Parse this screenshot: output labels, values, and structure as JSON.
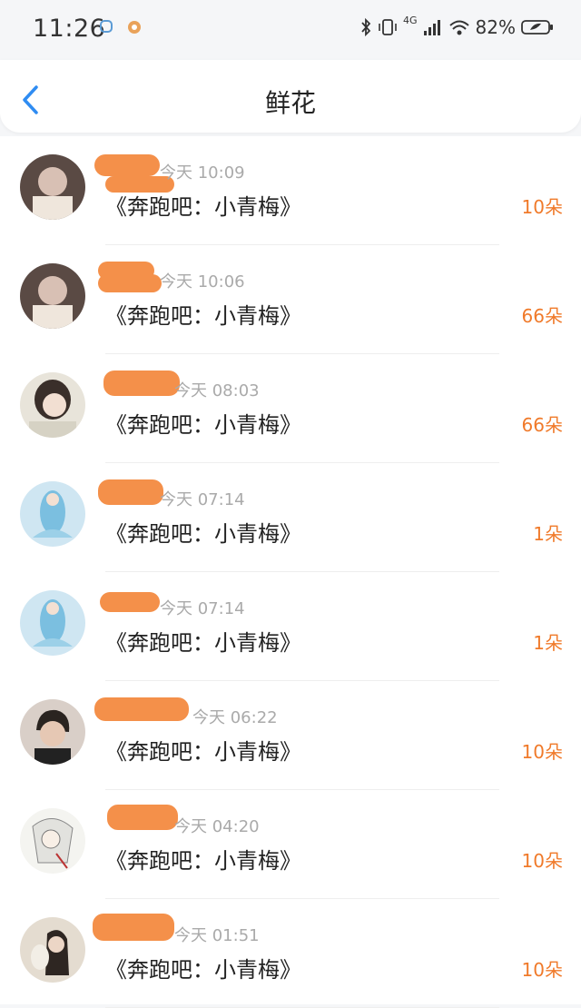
{
  "status_bar": {
    "time": "11:26",
    "network": "4G",
    "battery": "82%"
  },
  "header": {
    "title": "鲜花"
  },
  "items": [
    {
      "time": "今天 10:09",
      "title": "《奔跑吧：小青梅》",
      "count": "10朵"
    },
    {
      "time": "今天 10:06",
      "title": "《奔跑吧：小青梅》",
      "count": "66朵"
    },
    {
      "time": "今天 08:03",
      "title": "《奔跑吧：小青梅》",
      "count": "66朵"
    },
    {
      "time": "今天 07:14",
      "title": "《奔跑吧：小青梅》",
      "count": "1朵"
    },
    {
      "time": "今天 07:14",
      "title": "《奔跑吧：小青梅》",
      "count": "1朵"
    },
    {
      "time": "今天 06:22",
      "title": "《奔跑吧：小青梅》",
      "count": "10朵"
    },
    {
      "time": "今天 04:20",
      "title": "《奔跑吧：小青梅》",
      "count": "10朵"
    },
    {
      "time": "今天 01:51",
      "title": "《奔跑吧：小青梅》",
      "count": "10朵"
    }
  ],
  "colors": {
    "accent": "#2f8cf2",
    "count": "#f07a2a",
    "redaction": "#f4904a"
  }
}
